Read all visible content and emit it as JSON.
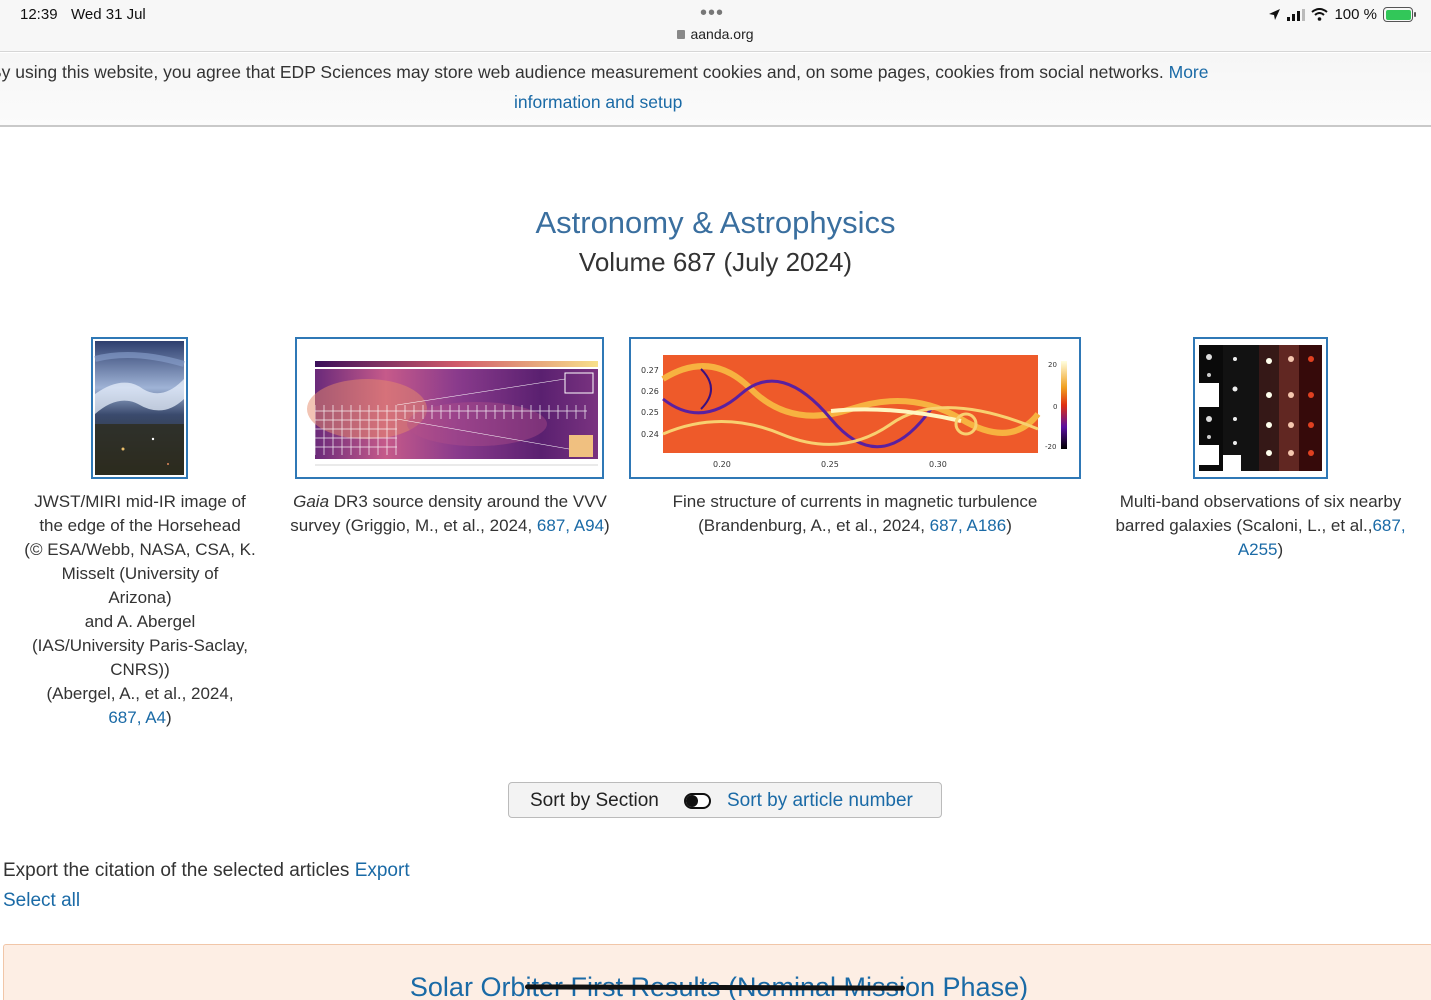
{
  "status_bar": {
    "time": "12:39",
    "date": "Wed 31 Jul",
    "url": "aanda.org",
    "battery": "100 %",
    "icons": [
      "location-icon",
      "cellular-signal-icon",
      "wifi-icon",
      "battery-charging-icon"
    ]
  },
  "cookie_banner": {
    "text": "By using this website, you agree that EDP Sciences may store web audience measurement cookies and, on some pages, cookies from social networks.",
    "link_part1": "More",
    "link_part2": "information and setup"
  },
  "journal": {
    "title": "Astronomy & Astrophysics",
    "volume": "Volume 687 (July 2024)"
  },
  "covers": [
    {
      "caption_lines": [
        "JWST/MIRI mid-IR image of",
        "the edge of the Horsehead",
        "(© ESA/Webb, NASA, CSA, K.",
        "Misselt (University of",
        "Arizona)",
        "and A. Abergel",
        "(IAS/University Paris-Saclay,",
        "CNRS))",
        "(Abergel, A., et al., 2024,"
      ],
      "link": "687, A4",
      "after_link": ")"
    },
    {
      "caption_italic": "Gaia",
      "caption_text": " DR3 source density around the VVV survey (Griggio, M., et al., 2024, ",
      "link": "687, A94",
      "after_link": ")"
    },
    {
      "caption_text": "Fine structure of currents in magnetic turbulence (Brandenburg, A., et al., 2024, ",
      "link": "687, A186",
      "after_link": ")",
      "axis": {
        "y_ticks": [
          "0.27",
          "0.26",
          "0.25",
          "0.24"
        ],
        "x_ticks": [
          "0.20",
          "0.25",
          "0.30"
        ],
        "colorbar_ticks": [
          "20",
          "0",
          "-20"
        ]
      }
    },
    {
      "caption_text": "Multi-band observations of six nearby barred galaxies (Scaloni, L., et al.,",
      "link": "687, A255",
      "after_link": ")"
    }
  ],
  "sort": {
    "section_label": "Sort by Section",
    "article_label": "Sort by article number"
  },
  "export": {
    "text": "Export the citation of the selected articles ",
    "link": "Export",
    "select_all": "Select all"
  },
  "section": {
    "title": "Solar Orbiter First Results (Nominal Mission Phase)"
  }
}
